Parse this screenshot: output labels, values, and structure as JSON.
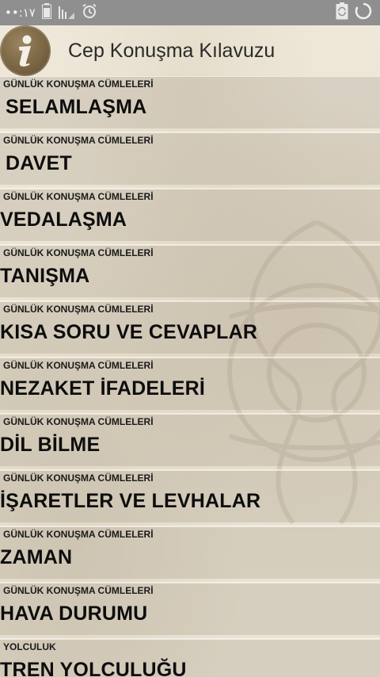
{
  "status_bar": {
    "left_text": "••:١٧",
    "icons": [
      "battery-icon",
      "signal-icon",
      "alarm-icon"
    ],
    "right_icons": [
      "sync-icon",
      "loading-icon"
    ]
  },
  "header": {
    "logo_icon": "info-icon",
    "title": "Cep Konuşma Kılavuzu"
  },
  "items": [
    {
      "category": "GÜNLÜK KONUŞMA CÜMLELERİ",
      "name": "SELAMLAŞMA",
      "indent": true
    },
    {
      "category": "GÜNLÜK KONUŞMA CÜMLELERİ",
      "name": "DAVET",
      "indent": true
    },
    {
      "category": "GÜNLÜK KONUŞMA CÜMLELERİ",
      "name": "VEDALAŞMA",
      "indent": false
    },
    {
      "category": "GÜNLÜK KONUŞMA CÜMLELERİ",
      "name": "TANIŞMA",
      "indent": false
    },
    {
      "category": "GÜNLÜK KONUŞMA CÜMLELERİ",
      "name": "KISA SORU VE CEVAPLAR",
      "indent": false
    },
    {
      "category": "GÜNLÜK KONUŞMA CÜMLELERİ",
      "name": "NEZAKET İFADELERİ",
      "indent": false
    },
    {
      "category": "GÜNLÜK KONUŞMA CÜMLELERİ",
      "name": "DİL BİLME",
      "indent": false
    },
    {
      "category": "GÜNLÜK KONUŞMA CÜMLELERİ",
      "name": "İŞARETLER VE LEVHALAR",
      "indent": false
    },
    {
      "category": "GÜNLÜK KONUŞMA CÜMLELERİ",
      "name": "ZAMAN",
      "indent": false
    },
    {
      "category": "GÜNLÜK KONUŞMA CÜMLELERİ",
      "name": "HAVA DURUMU",
      "indent": false
    },
    {
      "category": "YOLCULUK",
      "name": "TREN YOLCULUĞU",
      "indent": false
    }
  ]
}
